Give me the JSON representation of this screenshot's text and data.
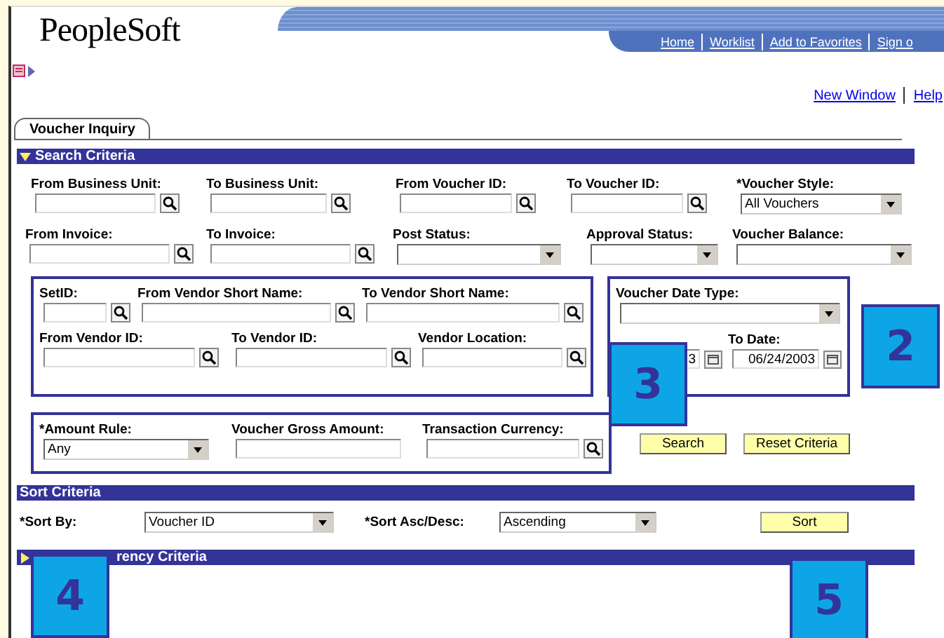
{
  "header": {
    "logo": "PeopleSoft",
    "links": [
      "Home",
      "Worklist",
      "Add to Favorites",
      "Sign o"
    ]
  },
  "page_links": [
    "New Window",
    "Help"
  ],
  "tabs": [
    {
      "label": "Voucher Inquiry",
      "selected": true
    }
  ],
  "search_criteria": {
    "title": "Search Criteria",
    "expanded": true,
    "rows": [
      [
        {
          "label": "From Business Unit:",
          "kind": "lookup"
        },
        {
          "label": "To Business Unit:",
          "kind": "lookup"
        },
        {
          "label": "From Voucher ID:",
          "kind": "lookup"
        },
        {
          "label": "To Voucher ID:",
          "kind": "lookup"
        },
        {
          "label": "*Voucher Style:",
          "kind": "select",
          "value": "All Vouchers"
        }
      ],
      [
        {
          "label": "From Invoice:",
          "kind": "lookup"
        },
        {
          "label": "To Invoice:",
          "kind": "lookup"
        },
        {
          "label": "Post Status:",
          "kind": "select"
        },
        {
          "label": "Approval Status:",
          "kind": "select"
        },
        {
          "label": "Voucher Balance:",
          "kind": "select"
        }
      ]
    ],
    "vendor_group": [
      [
        {
          "label": "SetID:",
          "kind": "lookup"
        },
        {
          "label": "From Vendor Short Name:",
          "kind": "lookup"
        },
        {
          "label": "To Vendor Short Name:",
          "kind": "lookup"
        }
      ],
      [
        {
          "label": "From Vendor ID:",
          "kind": "lookup"
        },
        {
          "label": "To Vendor ID:",
          "kind": "lookup"
        },
        {
          "label": "Vendor Location:",
          "kind": "lookup"
        }
      ]
    ],
    "date_group": [
      [
        {
          "label": "Voucher Date Type:",
          "kind": "select"
        }
      ],
      [
        {
          "kind": "date",
          "value": "3"
        },
        {
          "label": "To Date:",
          "kind": "date",
          "value": "06/24/2003"
        }
      ]
    ],
    "amount_group": [
      {
        "label": "*Amount Rule:",
        "kind": "select",
        "value": "Any"
      },
      {
        "label": "Voucher Gross Amount:",
        "kind": "text"
      },
      {
        "label": "Transaction Currency:",
        "kind": "lookup"
      }
    ],
    "buttons": [
      "Search",
      "Reset Criteria"
    ]
  },
  "sort_criteria": {
    "title": "Sort Criteria",
    "fields": [
      {
        "label": "*Sort By:",
        "kind": "select",
        "value": "Voucher ID"
      },
      {
        "label": "*Sort Asc/Desc:",
        "kind": "select",
        "value": "Ascending"
      }
    ],
    "button": "Sort"
  },
  "currency_criteria": {
    "title": "rency Criteria",
    "expanded": false
  },
  "callouts": [
    "2",
    "3",
    "4",
    "5"
  ]
}
